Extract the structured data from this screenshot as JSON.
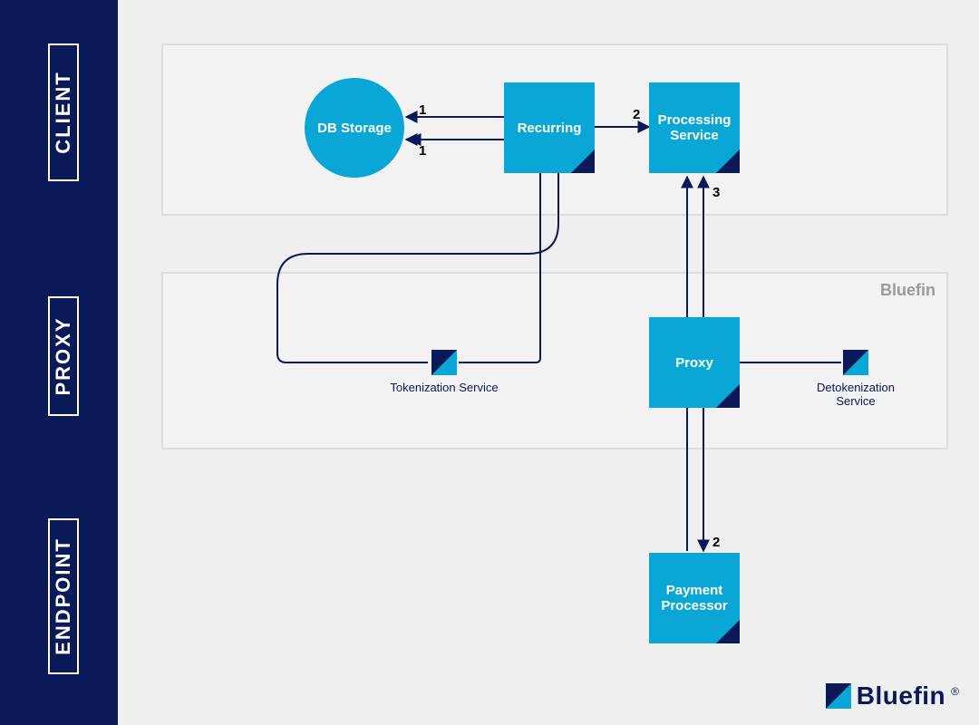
{
  "tiers": {
    "client": "CLIENT",
    "proxy": "PROXY",
    "endpoint": "ENDPOINT"
  },
  "panels": {
    "proxy_tag": "Bluefin"
  },
  "nodes": {
    "db_storage": "DB Storage",
    "recurring": "Recurring",
    "processing_service": "Processing Service",
    "proxy": "Proxy",
    "payment_processor": "Payment Processor"
  },
  "services": {
    "tokenization": "Tokenization Service",
    "detokenization": "Detokenization Service"
  },
  "edges": {
    "db_out": "1",
    "db_in": "1",
    "recurring_to_processing": "2",
    "proxy_to_processing": "3",
    "proxy_to_payment": "2"
  },
  "brand": {
    "name": "Bluefin",
    "reg": "®"
  },
  "colors": {
    "sidebar": "#0a1958",
    "accent": "#0aa6d6",
    "bg": "#efeff0"
  }
}
